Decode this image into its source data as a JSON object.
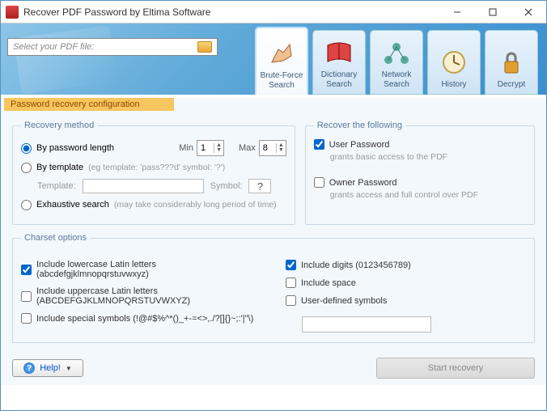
{
  "window": {
    "title": "Recover PDF Password by Eltima Software"
  },
  "banner": {
    "file_placeholder": "Select your PDF file:"
  },
  "tabs": {
    "brute": "Brute-Force Search",
    "dict": "Dictionary Search",
    "network": "Network Search",
    "history": "History",
    "decrypt": "Decrypt"
  },
  "config_label": "Password recovery configuration",
  "recovery": {
    "legend": "Recovery method",
    "by_len": "By password length",
    "min_lbl": "Min",
    "min_val": "1",
    "max_lbl": "Max",
    "max_val": "8",
    "by_tmpl": "By template",
    "tmpl_hint": "(eg template: 'pass???d' symbol: '?')",
    "tmpl_lbl": "Template:",
    "sym_lbl": "Symbol:",
    "sym_val": "?",
    "exhaustive": "Exhaustive search",
    "exhaustive_hint": "(may take considerably long period of time)"
  },
  "recover_following": {
    "legend": "Recover the following",
    "user_pw": "User Password",
    "user_desc": "grants basic access to the PDF",
    "owner_pw": "Owner Password",
    "owner_desc": "grants access and full control over PDF"
  },
  "charset": {
    "legend": "Charset options",
    "lower": "Include lowercase Latin letters (abcdefgjklmnopqrstuvwxyz)",
    "upper": "Include uppercase Latin letters (ABCDEFGJKLMNOPQRSTUVWXYZ)",
    "special": "Include special symbols (!@#$%^*()_+-=<>,./?[]{}~;:'|\"\\)",
    "digits": "Include digits (0123456789)",
    "space": "Include space",
    "userdef": "User-defined symbols"
  },
  "footer": {
    "help": "Help!",
    "start": "Start recovery"
  }
}
